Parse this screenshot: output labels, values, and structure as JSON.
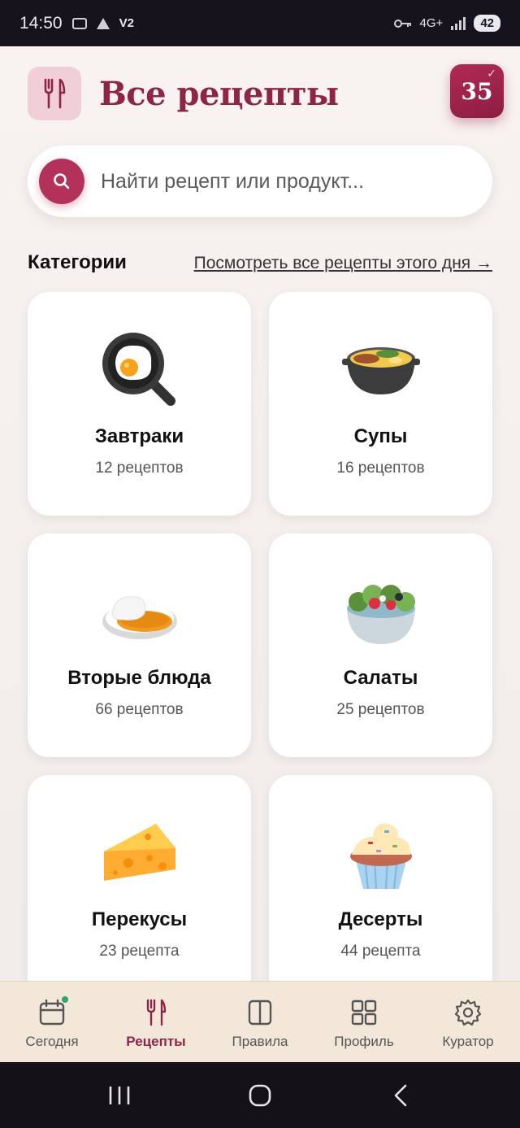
{
  "status_bar": {
    "time": "14:50",
    "carrier": "V2",
    "network": "4G+",
    "battery": "42"
  },
  "header": {
    "title": "Все рецепты",
    "day_badge": "35",
    "day_check": "✓"
  },
  "search": {
    "placeholder": "Найти рецепт или продукт..."
  },
  "categories_section": {
    "title": "Категории",
    "link": "Посмотреть все рецепты этого дня →"
  },
  "categories": [
    {
      "name": "Завтраки",
      "count": "12 рецептов",
      "icon": "frying-pan-egg-icon"
    },
    {
      "name": "Супы",
      "count": "16 рецептов",
      "icon": "soup-pot-icon"
    },
    {
      "name": "Вторые блюда",
      "count": "66 рецептов",
      "icon": "rice-curry-icon"
    },
    {
      "name": "Салаты",
      "count": "25 рецептов",
      "icon": "salad-bowl-icon"
    },
    {
      "name": "Перекусы",
      "count": "23 рецепта",
      "icon": "cheese-icon"
    },
    {
      "name": "Десерты",
      "count": "44 рецепта",
      "icon": "cupcake-icon"
    }
  ],
  "bottom_nav": [
    {
      "label": "Сегодня",
      "icon": "calendar-icon",
      "active": false
    },
    {
      "label": "Рецепты",
      "icon": "fork-knife-icon",
      "active": true
    },
    {
      "label": "Правила",
      "icon": "book-icon",
      "active": false
    },
    {
      "label": "Профиль",
      "icon": "grid-icon",
      "active": false
    },
    {
      "label": "Куратор",
      "icon": "gear-icon",
      "active": false
    }
  ],
  "colors": {
    "accent": "#8e2549",
    "accent_light": "#f0cfd8",
    "nav_bg": "#f3e7da"
  }
}
